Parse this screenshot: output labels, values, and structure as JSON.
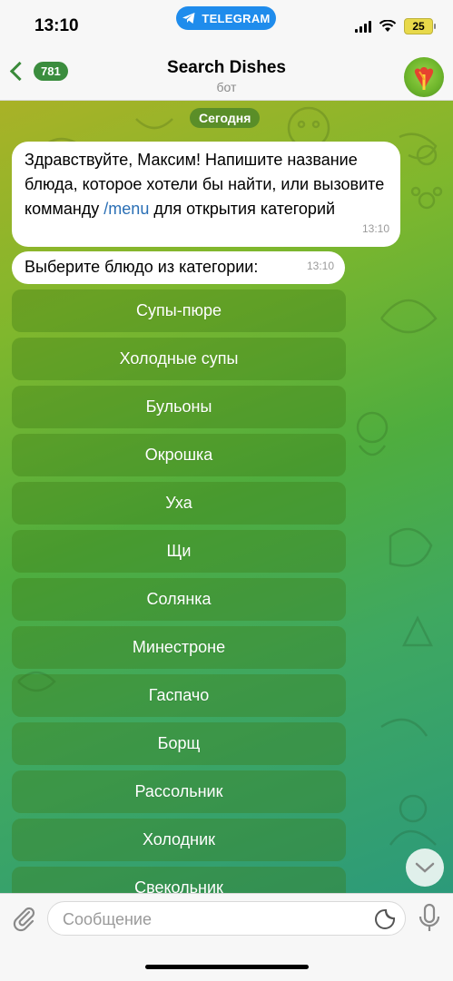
{
  "status": {
    "time": "13:10",
    "app_pill": "TELEGRAM",
    "battery": "25"
  },
  "nav": {
    "back_count": "781",
    "title": "Search Dishes",
    "subtitle": "бот"
  },
  "chat": {
    "date": "Сегодня",
    "messages": [
      {
        "text_before": "Здравствуйте, Максим! Напишите название блюда, которое хотели бы найти, или вызовите комманду ",
        "command": "/menu",
        "text_after": " для открытия категорий",
        "time": "13:10"
      },
      {
        "text": "Выберите блюдо из категории:",
        "time": "13:10"
      }
    ],
    "keyboard": [
      "Супы-пюре",
      "Холодные супы",
      "Бульоны",
      "Окрошка",
      "Уха",
      "Щи",
      "Солянка",
      "Минестроне",
      "Гаспачо",
      "Борщ",
      "Рассольник",
      "Холодник",
      "Свекольник"
    ]
  },
  "input": {
    "placeholder": "Сообщение"
  },
  "icons": {
    "attach": "paperclip-icon",
    "sticker": "sticker-icon",
    "mic": "microphone-icon",
    "scroll": "chevron-down-icon",
    "back": "chevron-left-icon"
  }
}
